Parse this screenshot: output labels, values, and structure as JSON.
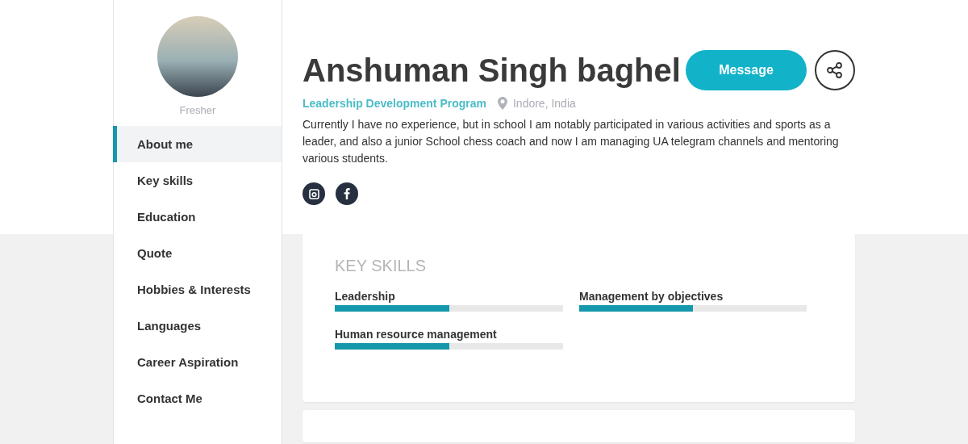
{
  "profile": {
    "role": "Fresher",
    "name": "Anshuman Singh baghel",
    "program": "Leadership Development Program",
    "location": "Indore, India",
    "bio": "Currently I have no experience, but in school I am notably participated in various activities and sports as a leader, and also a junior School chess coach and now I am managing UA telegram channels and mentoring various students.",
    "message_button": "Message"
  },
  "social_links": [
    {
      "kind": "instagram"
    },
    {
      "kind": "facebook"
    }
  ],
  "sidebar": {
    "items": [
      {
        "label": "About me",
        "selected": true
      },
      {
        "label": "Key skills",
        "selected": false
      },
      {
        "label": "Education",
        "selected": false
      },
      {
        "label": "Quote",
        "selected": false
      },
      {
        "label": "Hobbies & Interests",
        "selected": false
      },
      {
        "label": "Languages",
        "selected": false
      },
      {
        "label": "Career Aspiration",
        "selected": false
      },
      {
        "label": "Contact Me",
        "selected": false
      }
    ]
  },
  "key_skills": {
    "title": "KEY SKILLS",
    "skills": [
      {
        "name": "Leadership",
        "level": 0.5
      },
      {
        "name": "Management by objectives",
        "level": 0.5
      },
      {
        "name": "Human resource management",
        "level": 0.5
      }
    ]
  }
}
